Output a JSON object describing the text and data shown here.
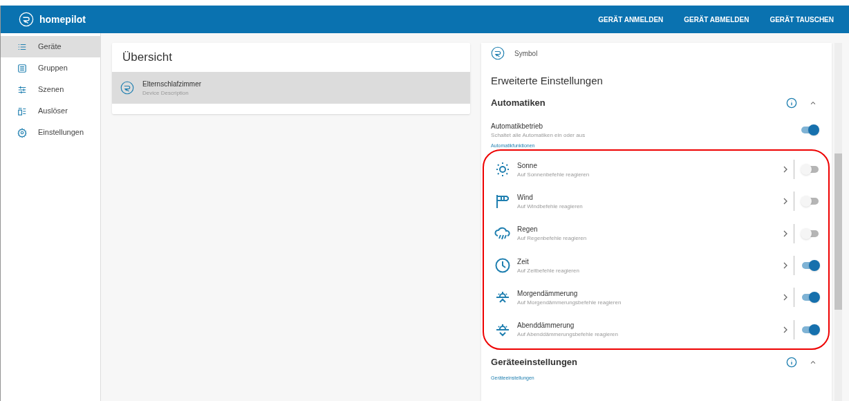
{
  "header": {
    "brand": "homepilot",
    "actions": [
      "GERÄT ANMELDEN",
      "GERÄT ABMELDEN",
      "GERÄT TAUSCHEN"
    ]
  },
  "sidebar": {
    "items": [
      {
        "label": "Geräte",
        "kind": "list",
        "selected": true
      },
      {
        "label": "Gruppen",
        "kind": "group",
        "selected": false
      },
      {
        "label": "Szenen",
        "kind": "sliders",
        "selected": false
      },
      {
        "label": "Auslöser",
        "kind": "trigger",
        "selected": false
      },
      {
        "label": "Einstellungen",
        "kind": "gear",
        "selected": false
      }
    ]
  },
  "overview": {
    "title": "Übersicht",
    "devices": [
      {
        "name": "Elternschlafzimmer",
        "description": "Device Description",
        "selected": true
      }
    ]
  },
  "details": {
    "symbol_label": "Symbol",
    "title": "Erweiterte Einstellungen",
    "automatics": {
      "title": "Automatiken",
      "expanded": true,
      "master": {
        "label": "Automatikbetrieb",
        "description": "Schaltet alle Automatiken ein oder aus",
        "on": true
      },
      "functions_label": "Automatikfunktionen",
      "functions": [
        {
          "kind": "sun",
          "label": "Sonne",
          "description": "Auf Sonnenbefehle reagieren",
          "on": false
        },
        {
          "kind": "wind",
          "label": "Wind",
          "description": "Auf Windbefehle reagieren",
          "on": false
        },
        {
          "kind": "rain",
          "label": "Regen",
          "description": "Auf Regenbefehle reagieren",
          "on": false
        },
        {
          "kind": "clock",
          "label": "Zeit",
          "description": "Auf Zeitbefehle reagieren",
          "on": true
        },
        {
          "kind": "dawn",
          "label": "Morgendämmerung",
          "description": "Auf Morgendämmerungsbefehle reagieren",
          "on": true
        },
        {
          "kind": "dusk",
          "label": "Abenddämmerung",
          "description": "Auf Abenddämmerungsbefehle reagieren",
          "on": true
        }
      ]
    },
    "device_settings": {
      "title": "Geräteeinstellungen",
      "expanded": true,
      "sub_label": "Geräteeinstellungen"
    }
  }
}
